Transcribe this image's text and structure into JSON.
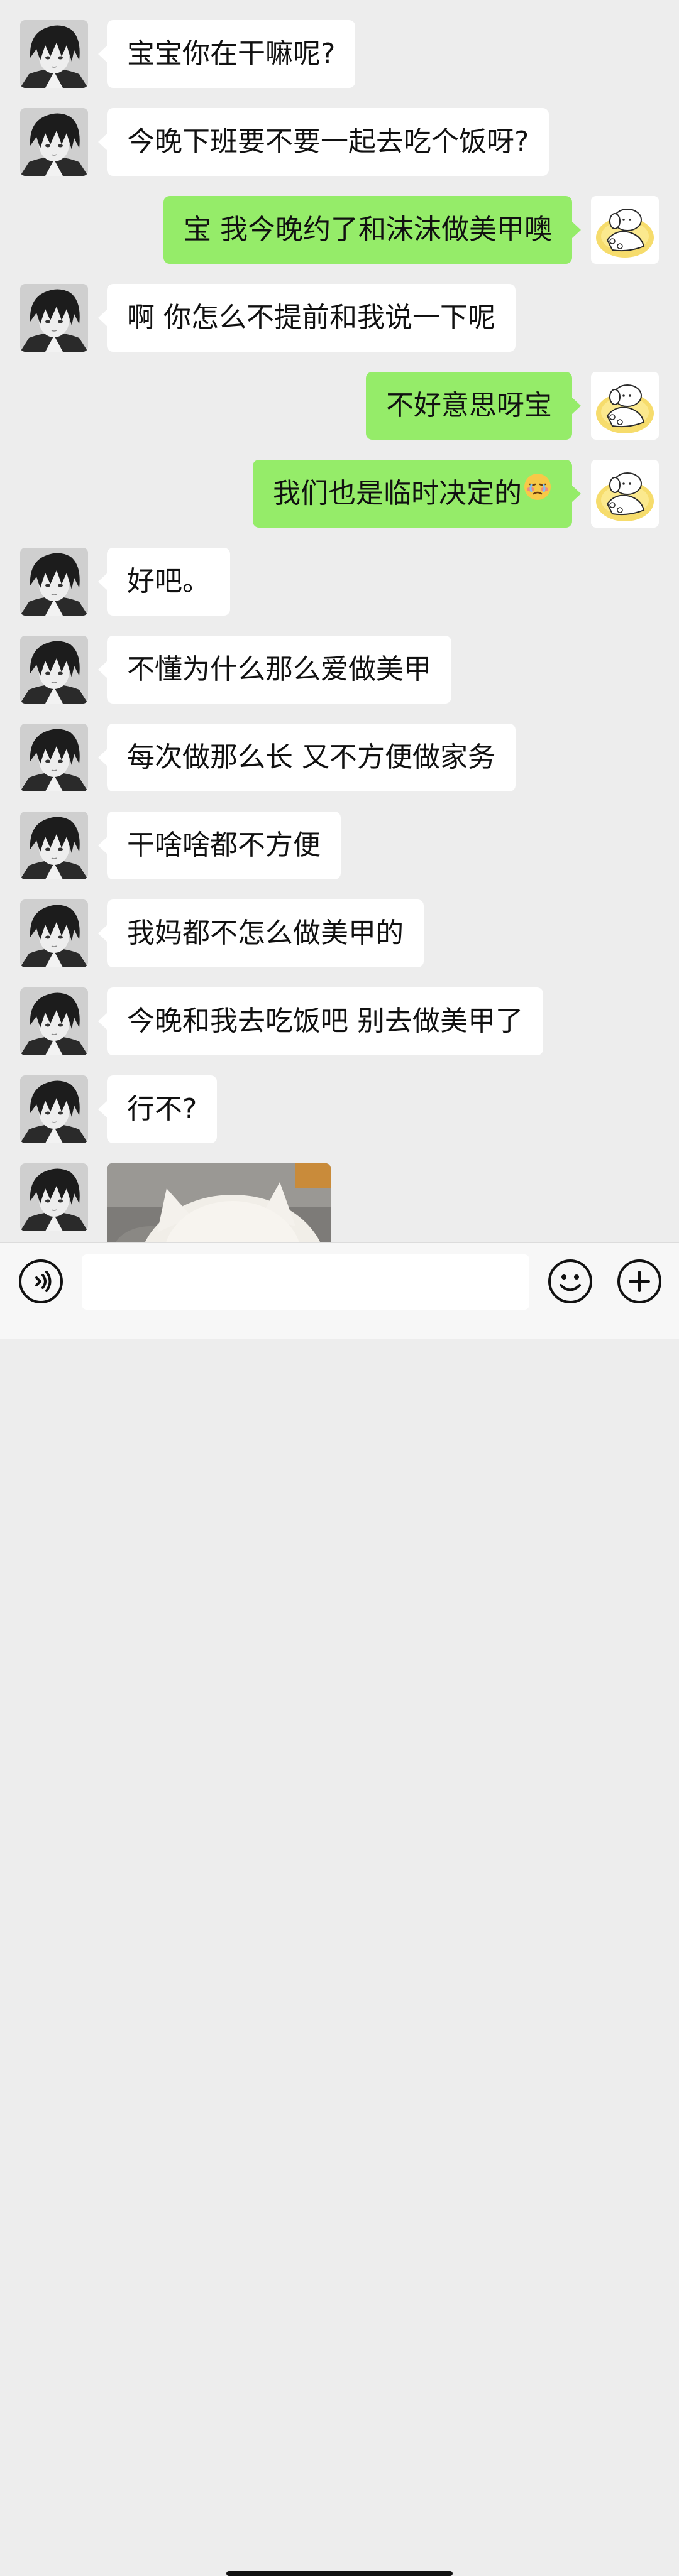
{
  "messages": [
    {
      "side": "in",
      "text": "宝宝你在干嘛呢?"
    },
    {
      "side": "in",
      "text": "今晚下班要不要一起去吃个饭呀?"
    },
    {
      "side": "out",
      "text": "宝 我今晚约了和沫沫做美甲噢"
    },
    {
      "side": "in",
      "text": "啊 你怎么不提前和我说一下呢"
    },
    {
      "side": "out",
      "text": "不好意思呀宝"
    },
    {
      "side": "out",
      "text": "我们也是临时决定的",
      "emoji": "blushing-tears-emoji"
    },
    {
      "side": "in",
      "text": "好吧。"
    },
    {
      "side": "in",
      "text": "不懂为什么那么爱做美甲"
    },
    {
      "side": "in",
      "text": "每次做那么长 又不方便做家务"
    },
    {
      "side": "in",
      "text": "干啥啥都不方便"
    },
    {
      "side": "in",
      "text": "我妈都不怎么做美甲的"
    },
    {
      "side": "in",
      "text": "今晚和我去吃饭吧 别去做美甲了"
    },
    {
      "side": "in",
      "text": "行不?"
    },
    {
      "side": "in",
      "type": "image",
      "image": "white-cat-photo"
    }
  ],
  "avatars": {
    "contact": "dark-hair-anime-boy-avatar",
    "self": "white-puppy-on-yellow-cushion-avatar"
  },
  "input_bar": {
    "voice_icon": "voice-icon",
    "text_value": "",
    "emoji_icon": "emoji-smile-icon",
    "plus_icon": "plus-circle-icon"
  },
  "colors": {
    "background": "#ededed",
    "incoming_bubble": "#ffffff",
    "outgoing_bubble": "#95ec69",
    "text": "#111111"
  }
}
